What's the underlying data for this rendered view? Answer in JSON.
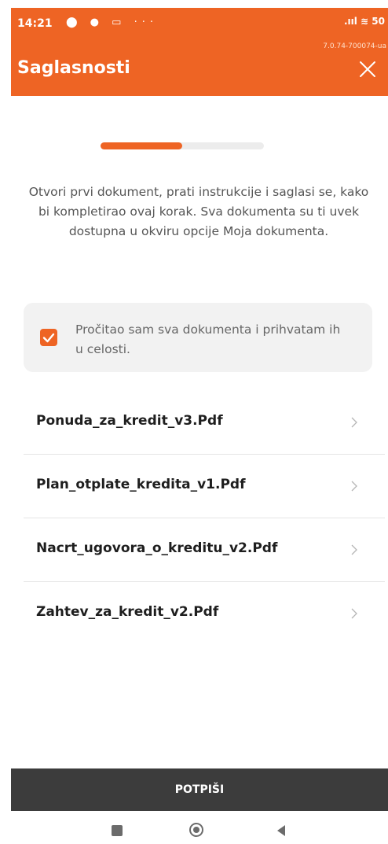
{
  "status_bar": {
    "time": "14:21",
    "icons_left": "⬤ ● ▭ ···",
    "icons_right": ".ııl ≋ 50",
    "version": "7.0.74-700074-ua"
  },
  "header": {
    "title": "Saglasnosti",
    "close_icon": "close-icon"
  },
  "progress": {
    "value": 0.5
  },
  "instructions": "Otvori prvi dokument, prati instrukcije i saglasi se, kako bi kompletirao ovaj korak. Sva dokumenta su ti uvek dostupna u okviru opcije Moja dokumenta.",
  "consent": {
    "checked": true,
    "label": "Pročitao sam sva dokumenta i prihvatam ih u celosti."
  },
  "documents": [
    {
      "name": "Ponuda_za_kredit_v3.Pdf"
    },
    {
      "name": "Plan_otplate_kredita_v1.Pdf"
    },
    {
      "name": "Nacrt_ugovora_o_kreditu_v2.Pdf"
    },
    {
      "name": "Zahtev_za_kredit_v2.Pdf"
    }
  ],
  "sign_button": "POTPIŠI",
  "colors": {
    "accent": "#ee6424",
    "sign_bar": "#3c3c3c",
    "consent_bg": "#f2f2f2"
  }
}
